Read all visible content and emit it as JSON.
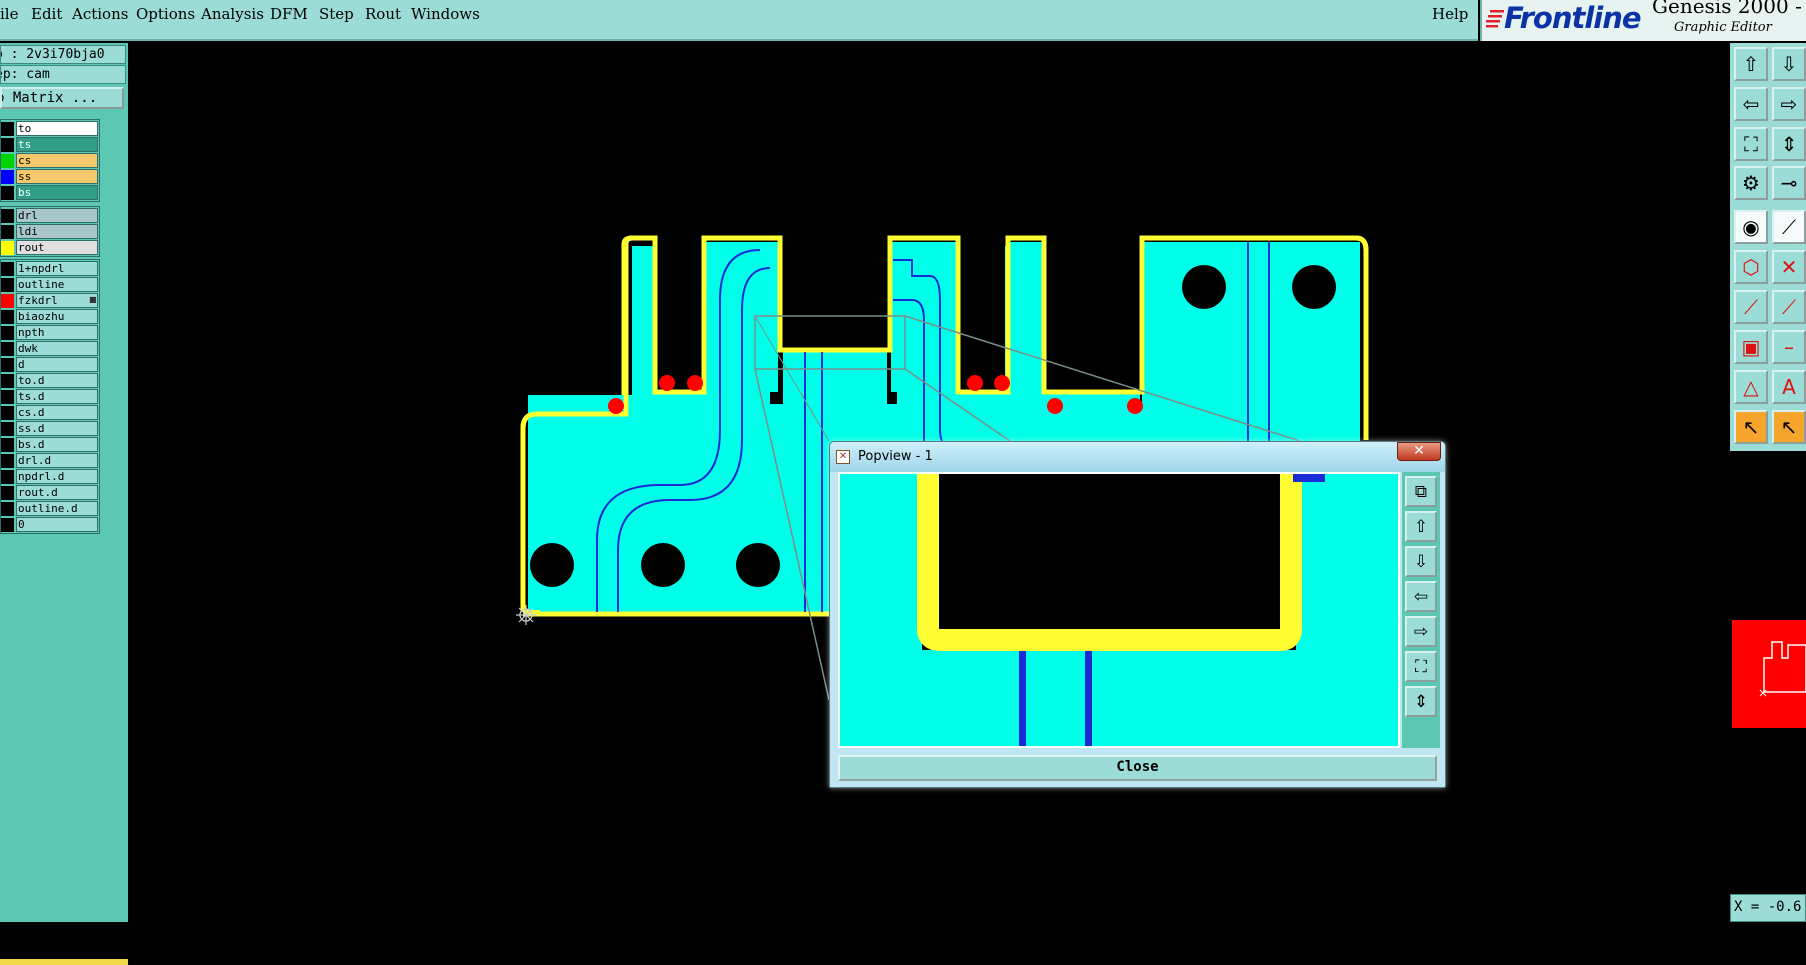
{
  "menu": {
    "items": [
      "ile",
      "Edit",
      "Actions",
      "Options",
      "Analysis",
      "DFM",
      "Step",
      "Rout",
      "Windows"
    ],
    "help": "Help"
  },
  "brand": {
    "logo": "Frontline",
    "title": "Genesis 2000 -",
    "subtitle": "Graphic Editor"
  },
  "left_panel": {
    "job": "b : 2v3i70bja0",
    "step": "ep: cam",
    "matrix_button": "b Matrix ...",
    "layer_groups": [
      [
        {
          "name": "to",
          "swatch": "#000000",
          "style": "white"
        },
        {
          "name": "ts",
          "swatch": "#000000",
          "style": "teal"
        },
        {
          "name": "cs",
          "swatch": "#00d400",
          "style": "orange"
        },
        {
          "name": "ss",
          "swatch": "#0000ff",
          "style": "orange"
        },
        {
          "name": "bs",
          "swatch": "#000000",
          "style": "teal"
        }
      ],
      [
        {
          "name": "drl",
          "swatch": "#000000",
          "style": "gray"
        },
        {
          "name": "ldi",
          "swatch": "#000000",
          "style": "gray"
        },
        {
          "name": "rout",
          "swatch": "#ffff00",
          "style": "lgray"
        }
      ],
      [
        {
          "name": "1+npdrl",
          "swatch": "#000000",
          "style": "norm"
        },
        {
          "name": "outline",
          "swatch": "#000000",
          "style": "norm"
        },
        {
          "name": "fzkdrl",
          "swatch": "#ff0000",
          "style": "norm",
          "marker": "■"
        },
        {
          "name": "biaozhu",
          "swatch": "#000000",
          "style": "norm"
        },
        {
          "name": "npth",
          "swatch": "#000000",
          "style": "norm"
        },
        {
          "name": "dwk",
          "swatch": "#000000",
          "style": "norm"
        },
        {
          "name": "d",
          "swatch": "#000000",
          "style": "norm"
        },
        {
          "name": "to.d",
          "swatch": "#000000",
          "style": "norm"
        },
        {
          "name": "ts.d",
          "swatch": "#000000",
          "style": "norm"
        },
        {
          "name": "cs.d",
          "swatch": "#000000",
          "style": "norm"
        },
        {
          "name": "ss.d",
          "swatch": "#000000",
          "style": "norm"
        },
        {
          "name": "bs.d",
          "swatch": "#000000",
          "style": "norm"
        },
        {
          "name": "drl.d",
          "swatch": "#000000",
          "style": "norm"
        },
        {
          "name": "npdrl.d",
          "swatch": "#000000",
          "style": "norm"
        },
        {
          "name": "rout.d",
          "swatch": "#000000",
          "style": "norm"
        },
        {
          "name": "outline.d",
          "swatch": "#000000",
          "style": "norm"
        },
        {
          "name": "0",
          "swatch": "#000000",
          "style": "norm"
        }
      ]
    ]
  },
  "right_toolbar": {
    "coord": "X = -0.6",
    "buttons": [
      [
        "zoom-home-icon",
        "zoom-back-icon"
      ],
      [
        "pan-left-icon",
        "pan-right-icon"
      ],
      [
        "zoom-fit-icon",
        "zoom-area-icon"
      ],
      [
        "measure-icon",
        "snap-icon"
      ],
      [
        "select-pad-icon",
        "select-line-icon"
      ],
      [
        "nodes-icon",
        "cross-icon"
      ],
      [
        "slope-icon",
        "slope-alt-icon"
      ],
      [
        "pad-move-icon",
        "line-split-icon"
      ],
      [
        "triangle-icon",
        "letter-a-icon"
      ],
      [
        "pointer-icon",
        "pointer-alt-icon"
      ]
    ]
  },
  "popview": {
    "title": "Popview - 1",
    "close_label": "Close",
    "buttons": [
      "zoom-window-icon",
      "zoom-home-icon",
      "zoom-back-icon",
      "pan-left-icon",
      "pan-right-icon",
      "zoom-fit-icon",
      "zoom-in-icon"
    ]
  },
  "colors": {
    "board": "#00ffe8",
    "rout": "#ffff33",
    "trace": "#1b2bd6",
    "drill": "#000000",
    "pad": "#ff0000",
    "panel": "#5cc8b4",
    "menubar": "#9cdcd6"
  }
}
